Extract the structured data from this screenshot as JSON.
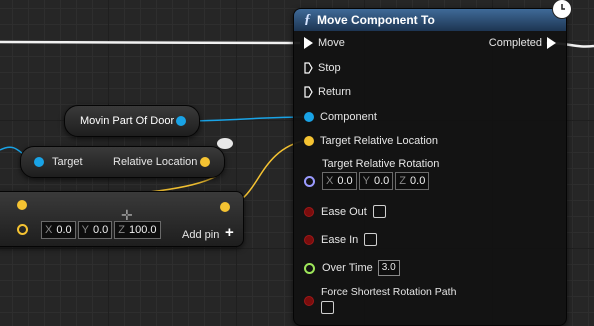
{
  "header": {
    "title": "Move Component To"
  },
  "move_component_to": {
    "exec_inputs": [
      {
        "label": "Move"
      },
      {
        "label": "Stop"
      },
      {
        "label": "Return"
      }
    ],
    "exec_output": {
      "label": "Completed"
    },
    "pins": {
      "component": "Component",
      "target_relative_location": "Target Relative Location",
      "target_relative_rotation": "Target Relative Rotation",
      "rotation": {
        "x": "0.0",
        "y": "0.0",
        "z": "0.0",
        "x_label": "X",
        "y_label": "Y",
        "z_label": "Z"
      },
      "ease_out": "Ease Out",
      "ease_in": "Ease In",
      "over_time": "Over Time",
      "over_time_value": "3.0",
      "force_shortest": "Force Shortest Rotation Path"
    }
  },
  "door_node": {
    "label": "Movin Part Of Door"
  },
  "target_node": {
    "target_label": "Target",
    "output_label": "Relative Location"
  },
  "add_node": {
    "x_label": "X",
    "x": "0.0",
    "y_label": "Y",
    "y": "0.0",
    "z_label": "Z",
    "z": "100.0",
    "add_pin": "Add pin",
    "plus": "+"
  },
  "colors": {
    "object_pin": "#19a3e6",
    "vector_pin": "#f5c332",
    "rotator_pin": "#9b9bff",
    "bool_pin": "#8c0f0f",
    "float_pin": "#9ee65a",
    "exec_pin": "#ffffff"
  },
  "icons": {
    "function": "function-icon",
    "latent": "clock-icon"
  }
}
